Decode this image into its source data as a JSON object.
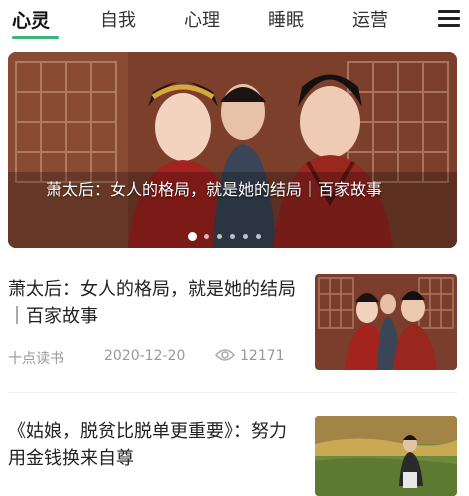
{
  "tabs": [
    {
      "label": "心灵",
      "active": true
    },
    {
      "label": "自我",
      "active": false
    },
    {
      "label": "心理",
      "active": false
    },
    {
      "label": "睡眠",
      "active": false
    },
    {
      "label": "运营",
      "active": false
    }
  ],
  "accent_color": "#3bb37a",
  "menu_icon": "hamburger-menu-icon",
  "banner": {
    "caption": "萧太后：女人的格局，就是她的结局｜百家故事",
    "slide_count": 6,
    "active_slide": 1
  },
  "articles": [
    {
      "title": "萧太后：女人的格局，就是她的结局｜百家故事",
      "source": "十点读书",
      "date": "2020-12-20",
      "views": "12171",
      "views_icon": "eye-icon"
    },
    {
      "title": "《姑娘，脱贫比脱单更重要》：努力用金钱换来自尊"
    }
  ]
}
